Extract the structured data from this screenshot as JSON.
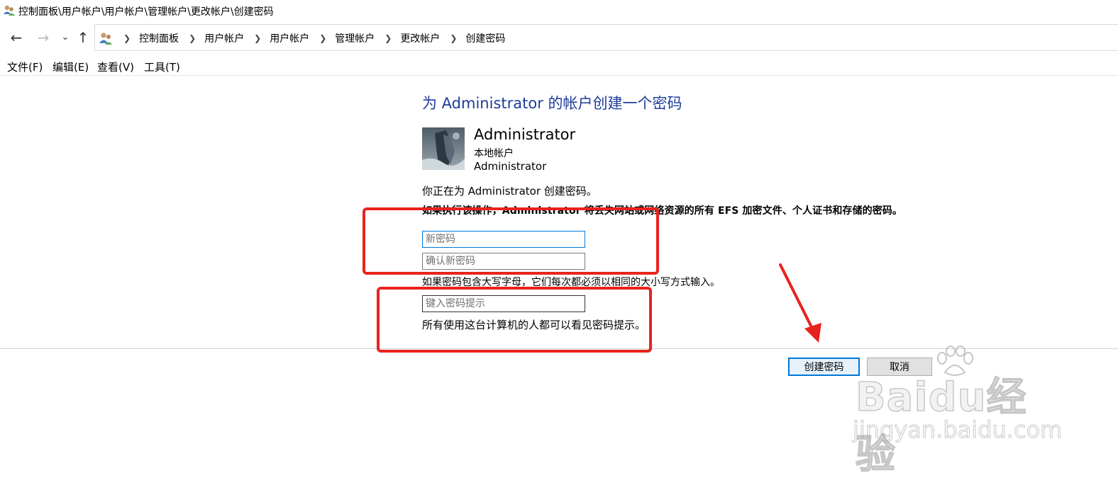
{
  "window": {
    "title": "控制面板\\用户帐户\\用户帐户\\管理帐户\\更改帐户\\创建密码"
  },
  "breadcrumb": [
    "控制面板",
    "用户帐户",
    "用户帐户",
    "管理帐户",
    "更改帐户",
    "创建密码"
  ],
  "nav": {
    "back_icon": "back-arrow-icon",
    "forward_icon": "forward-arrow-icon",
    "recent_icon": "chevron-down-icon",
    "up_icon": "up-arrow-icon"
  },
  "menu": [
    "文件(F)",
    "编辑(E)",
    "查看(V)",
    "工具(T)"
  ],
  "page": {
    "heading": "为 Administrator 的帐户创建一个密码",
    "account": {
      "name": "Administrator",
      "type": "本地帐户",
      "sub": "Administrator"
    },
    "creating_text": "你正在为 Administrator 创建密码。",
    "warning": "如果执行该操作，Administrator 将丢失网站或网络资源的所有 EFS 加密文件、个人证书和存储的密码。",
    "new_password": {
      "placeholder": "新密码",
      "value": ""
    },
    "confirm_password": {
      "placeholder": "确认新密码",
      "value": ""
    },
    "case_hint": "如果密码包含大写字母，它们每次都必须以相同的大小写方式输入。",
    "password_hint": {
      "placeholder": "键入密码提示",
      "value": ""
    },
    "hint_visibility": "所有使用这台计算机的人都可以看见密码提示。"
  },
  "buttons": {
    "create": "创建密码",
    "cancel": "取消"
  },
  "watermark": {
    "logo": "Baidu经验",
    "url": "jingyan.baidu.com"
  },
  "colors": {
    "heading": "#1e3c9a",
    "annotation_red": "#e8231f",
    "focus_blue": "#0078d7"
  }
}
